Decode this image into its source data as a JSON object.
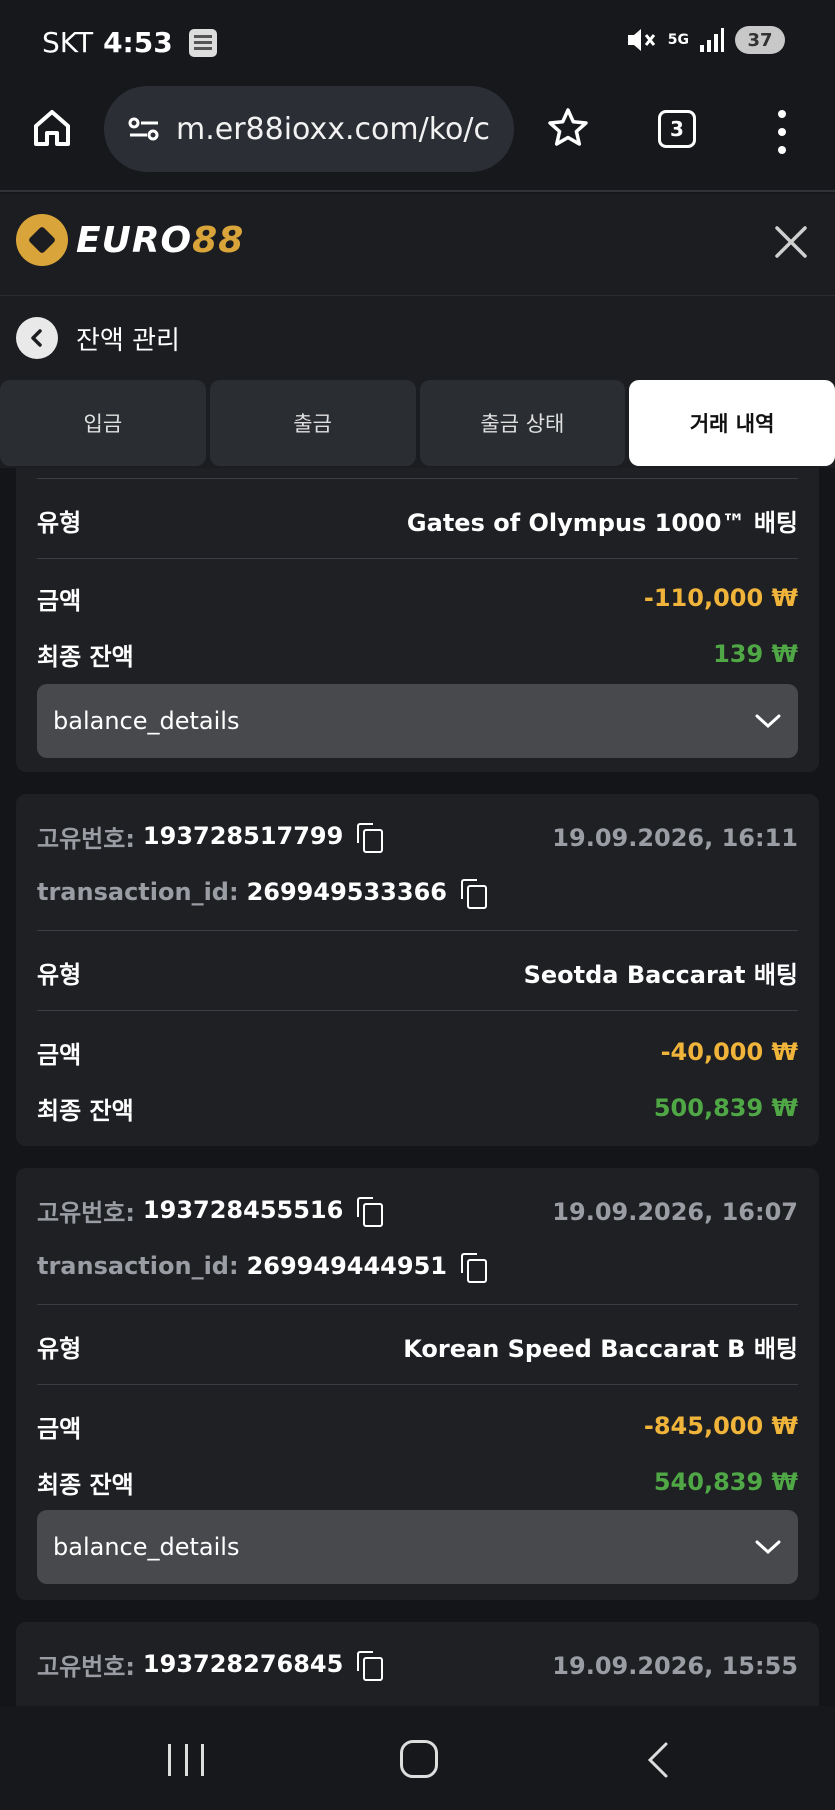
{
  "status_bar": {
    "carrier": "SKT",
    "time": "4:53",
    "network": "5G",
    "battery": "37"
  },
  "browser": {
    "url": "m.er88ioxx.com/ko/c",
    "tab_count": "3"
  },
  "site": {
    "logo_prefix": "EURO",
    "logo_suffix": "88"
  },
  "page": {
    "title": "잔액 관리"
  },
  "tabs": [
    {
      "label": "입금",
      "active": false
    },
    {
      "label": "출금",
      "active": false
    },
    {
      "label": "출금 상태",
      "active": false
    },
    {
      "label": "거래 내역",
      "active": true
    }
  ],
  "labels": {
    "type": "유형",
    "amount": "금액",
    "final_balance": "최종 잔액",
    "unique_id": "고유번호:",
    "transaction_id": "transaction_id:",
    "balance_details": "balance_details"
  },
  "transactions": [
    {
      "type": "Gates of Olympus 1000™ 배팅",
      "amount": "-110,000 ₩",
      "final_balance": "139 ₩"
    },
    {
      "unique_id": "193728517799",
      "date": "19.09.2026, 16:11",
      "transaction_id": "269949533366",
      "type": "Seotda Baccarat 배팅",
      "amount": "-40,000 ₩",
      "final_balance": "500,839 ₩"
    },
    {
      "unique_id": "193728455516",
      "date": "19.09.2026, 16:07",
      "transaction_id": "269949444951",
      "type": "Korean Speed Baccarat B 배팅",
      "amount": "-845,000 ₩",
      "final_balance": "540,839 ₩"
    },
    {
      "unique_id": "193728276845",
      "date": "19.09.2026, 15:55"
    }
  ],
  "colors": {
    "negative": "#f0b43a",
    "positive": "#4fa845",
    "accent": "#d9a53a"
  }
}
